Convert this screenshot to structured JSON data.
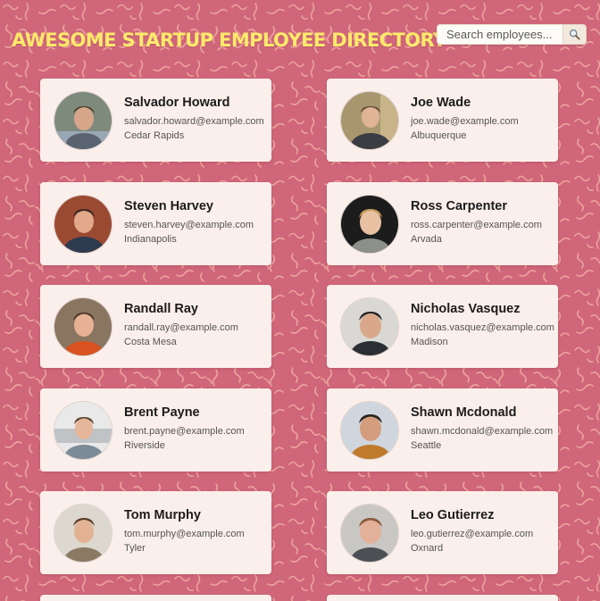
{
  "header": {
    "title": "AWESOME STARTUP EMPLOYEE DIRECTORY",
    "search": {
      "placeholder": "Search employees...",
      "value": "",
      "button_icon": "search-icon"
    }
  },
  "colors": {
    "background": "#d0667a",
    "pattern": "#f4b7a6",
    "title": "#ffea6b",
    "card": "#fbefeb"
  },
  "employees": [
    {
      "name": "Salvador Howard",
      "email": "salvador.howard@example.com",
      "city": "Cedar Rapids",
      "avatar": "person-photo"
    },
    {
      "name": "Joe Wade",
      "email": "joe.wade@example.com",
      "city": "Albuquerque",
      "avatar": "person-photo"
    },
    {
      "name": "Steven Harvey",
      "email": "steven.harvey@example.com",
      "city": "Indianapolis",
      "avatar": "person-photo"
    },
    {
      "name": "Ross Carpenter",
      "email": "ross.carpenter@example.com",
      "city": "Arvada",
      "avatar": "person-photo"
    },
    {
      "name": "Randall Ray",
      "email": "randall.ray@example.com",
      "city": "Costa Mesa",
      "avatar": "person-photo"
    },
    {
      "name": "Nicholas Vasquez",
      "email": "nicholas.vasquez@example.com",
      "city": "Madison",
      "avatar": "person-photo"
    },
    {
      "name": "Brent Payne",
      "email": "brent.payne@example.com",
      "city": "Riverside",
      "avatar": "person-photo"
    },
    {
      "name": "Shawn Mcdonald",
      "email": "shawn.mcdonald@example.com",
      "city": "Seattle",
      "avatar": "person-photo"
    },
    {
      "name": "Tom Murphy",
      "email": "tom.murphy@example.com",
      "city": "Tyler",
      "avatar": "person-photo"
    },
    {
      "name": "Leo Gutierrez",
      "email": "leo.gutierrez@example.com",
      "city": "Oxnard",
      "avatar": "person-photo"
    },
    {
      "name": "",
      "email": "",
      "city": "",
      "avatar": "person-photo"
    },
    {
      "name": "",
      "email": "",
      "city": "",
      "avatar": "person-photo"
    }
  ]
}
